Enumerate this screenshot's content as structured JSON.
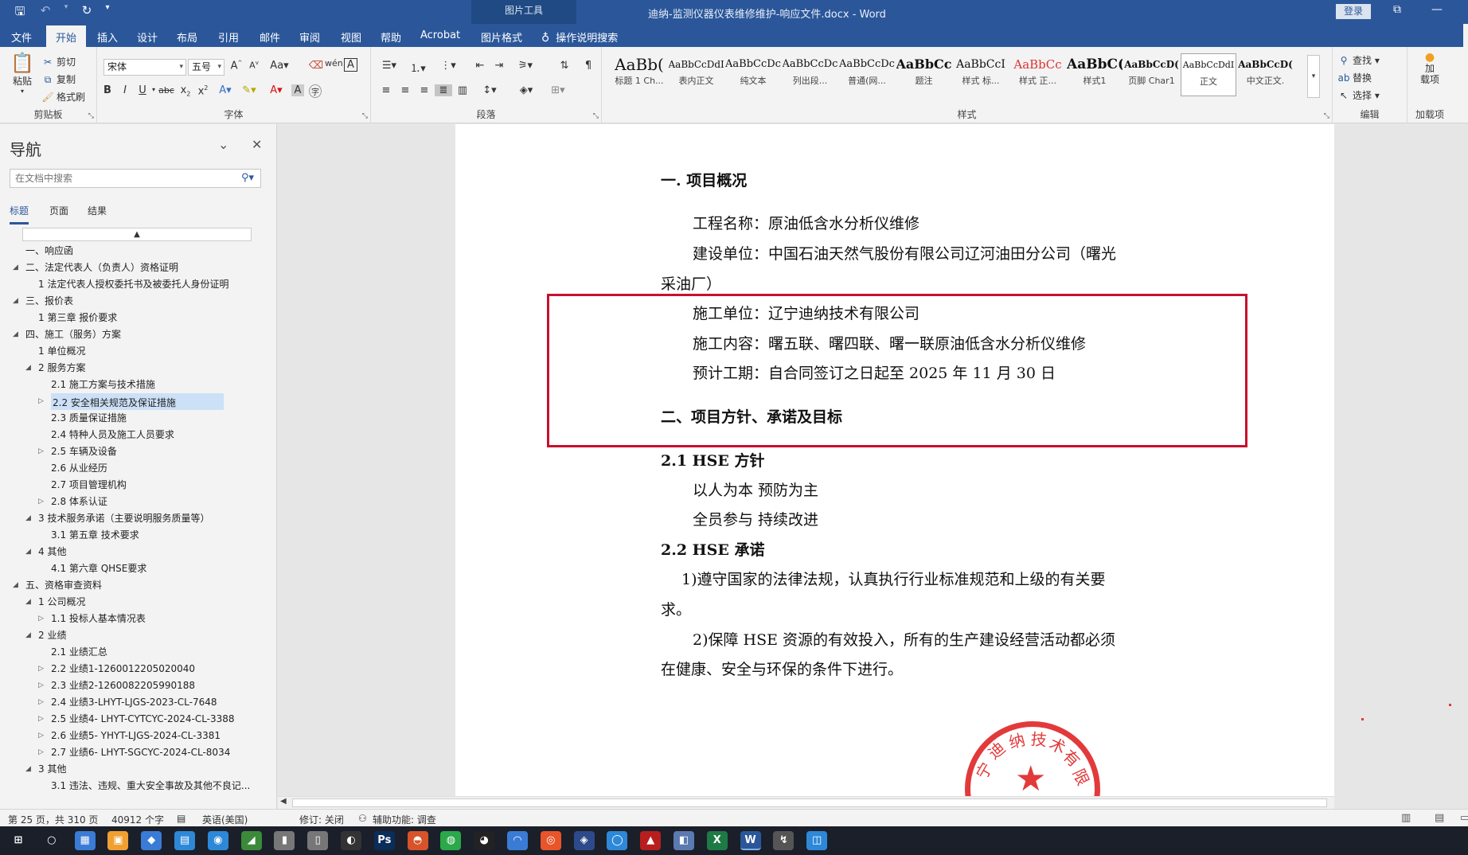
{
  "titlebar": {
    "contextual_tab": "图片工具",
    "document_title": "迪纳-监测仪器仪表维修维护-响应文件.docx  -  Word",
    "login": "登录"
  },
  "tabs": [
    {
      "label": "文件"
    },
    {
      "label": "开始"
    },
    {
      "label": "插入"
    },
    {
      "label": "设计"
    },
    {
      "label": "布局"
    },
    {
      "label": "引用"
    },
    {
      "label": "邮件"
    },
    {
      "label": "审阅"
    },
    {
      "label": "视图"
    },
    {
      "label": "帮助"
    },
    {
      "label": "Acrobat"
    },
    {
      "label": "图片格式"
    }
  ],
  "tell_me": "操作说明搜索",
  "ribbon": {
    "clipboard": {
      "paste": "粘贴",
      "cut": "剪切",
      "copy": "复制",
      "format_painter": "格式刷",
      "label": "剪贴板"
    },
    "font": {
      "name": "宋体",
      "size": "五号",
      "label": "字体"
    },
    "paragraph": {
      "label": "段落"
    },
    "styles": {
      "label": "样式",
      "items": [
        {
          "sample": "AaBb(",
          "name": "标题 1 Ch..."
        },
        {
          "sample": "AaBbCcDdI",
          "name": "表内正文"
        },
        {
          "sample": "AaBbCcDc",
          "name": "纯文本"
        },
        {
          "sample": "AaBbCcDc",
          "name": "列出段..."
        },
        {
          "sample": "AaBbCcDc",
          "name": "普通(网..."
        },
        {
          "sample": "AaBbCc",
          "name": "题注"
        },
        {
          "sample": "AaBbCcI",
          "name": "样式 标..."
        },
        {
          "sample": "AaBbCc",
          "name": "样式 正..."
        },
        {
          "sample": "AaBbC(",
          "name": "样式1"
        },
        {
          "sample": "AaBbCcD(",
          "name": "页脚 Char1"
        },
        {
          "sample": "AaBbCcDdI",
          "name": "正文"
        },
        {
          "sample": "AaBbCcD(",
          "name": "中文正文."
        }
      ]
    },
    "editing": {
      "find": "查找",
      "replace": "替换",
      "select": "选择",
      "label": "编辑"
    },
    "addins": {
      "button": "加\n载项",
      "label": "加载项"
    }
  },
  "nav": {
    "title": "导航",
    "search_placeholder": "在文档中搜索",
    "tabs": [
      {
        "label": "标题"
      },
      {
        "label": "页面"
      },
      {
        "label": "结果"
      }
    ],
    "items": [
      {
        "text": "一、响应函",
        "level": 0,
        "expand": ""
      },
      {
        "text": "二、法定代表人（负责人）资格证明",
        "level": 0,
        "expand": "open"
      },
      {
        "text": "1 法定代表人授权委托书及被委托人身份证明",
        "level": 1,
        "expand": ""
      },
      {
        "text": "三、报价表",
        "level": 0,
        "expand": "open"
      },
      {
        "text": "1 第三章 报价要求",
        "level": 1,
        "expand": ""
      },
      {
        "text": "四、施工（服务）方案",
        "level": 0,
        "expand": "open"
      },
      {
        "text": "1 单位概况",
        "level": 1,
        "expand": ""
      },
      {
        "text": "2 服务方案",
        "level": 1,
        "expand": "open"
      },
      {
        "text": "2.1 施工方案与技术措施",
        "level": 2,
        "expand": ""
      },
      {
        "text": "2.2 安全相关规范及保证措施",
        "level": 2,
        "expand": "closed",
        "selected": true
      },
      {
        "text": "2.3 质量保证措施",
        "level": 2,
        "expand": ""
      },
      {
        "text": "2.4 特种人员及施工人员要求",
        "level": 2,
        "expand": ""
      },
      {
        "text": "2.5 车辆及设备",
        "level": 2,
        "expand": "closed"
      },
      {
        "text": "2.6 从业经历",
        "level": 2,
        "expand": ""
      },
      {
        "text": "2.7 项目管理机构",
        "level": 2,
        "expand": ""
      },
      {
        "text": "2.8 体系认证",
        "level": 2,
        "expand": "closed"
      },
      {
        "text": "3 技术服务承诺（主要说明服务质量等）",
        "level": 1,
        "expand": "open"
      },
      {
        "text": "3.1 第五章 技术要求",
        "level": 2,
        "expand": ""
      },
      {
        "text": "4 其他",
        "level": 1,
        "expand": "open"
      },
      {
        "text": "4.1 第六章 QHSE要求",
        "level": 2,
        "expand": ""
      },
      {
        "text": "五、资格审查资料",
        "level": 0,
        "expand": "open"
      },
      {
        "text": "1 公司概况",
        "level": 1,
        "expand": "open"
      },
      {
        "text": "1.1 投标人基本情况表",
        "level": 2,
        "expand": "closed"
      },
      {
        "text": "2 业绩",
        "level": 1,
        "expand": "open"
      },
      {
        "text": "2.1 业绩汇总",
        "level": 2,
        "expand": ""
      },
      {
        "text": "2.2 业绩1-1260012205020040",
        "level": 2,
        "expand": "closed"
      },
      {
        "text": "2.3 业绩2-1260082205990188",
        "level": 2,
        "expand": "closed"
      },
      {
        "text": "2.4 业绩3-LHYT-LJGS-2023-CL-7648",
        "level": 2,
        "expand": "closed"
      },
      {
        "text": "2.5 业绩4- LHYT-CYTCYC-2024-CL-3388",
        "level": 2,
        "expand": "closed"
      },
      {
        "text": "2.6 业绩5- YHYT-LJGS-2024-CL-3381",
        "level": 2,
        "expand": "closed"
      },
      {
        "text": "2.7 业绩6- LHYT-SGCYC-2024-CL-8034",
        "level": 2,
        "expand": "closed"
      },
      {
        "text": "3 其他",
        "level": 1,
        "expand": "open"
      },
      {
        "text": "3.1 违法、违规、重大安全事故及其他不良记...",
        "level": 2,
        "expand": ""
      }
    ]
  },
  "document": {
    "h1": "一. 项目概况",
    "project_name": "工程名称：原油低含水分析仪维修",
    "builder_line1": "建设单位：中国石油天然气股份有限公司辽河油田分公司（曙光",
    "builder_line2": "采油厂）",
    "constructor": "施工单位：辽宁迪纳技术有限公司",
    "content": "施工内容：曙五联、曙四联、曙一联原油低含水分析仪维修",
    "period": "预计工期：自合同签订之日起至 2025 年 11 月 30 日",
    "h2": "二、项目方针、承诺及目标",
    "h21": "2.1 HSE 方针",
    "policy1": "以人为本 预防为主",
    "policy2": "全员参与 持续改进",
    "h22": "2.2 HSE 承诺",
    "commit1_line1": "1)遵守国家的法律法规，认真执行行业标准规范和上级的有关要",
    "commit1_line2": "求。",
    "commit2_line1": "2)保障 HSE 资源的有效投入，所有的生产建设经营活动都必须",
    "commit2_line2": "在健康、安全与环保的条件下进行。",
    "seal_chars": [
      "宁",
      "迪",
      "纳",
      "技",
      "术",
      "有",
      "限"
    ]
  },
  "status": {
    "page": "第 25 页，共 310 页",
    "words": "40912 个字",
    "language": "英语(美国)",
    "track": "修订: 关闭",
    "accessibility": "辅助功能: 调查"
  },
  "taskbar": {
    "items": [
      {
        "icon": "windows-icon",
        "glyph": "⊞"
      },
      {
        "icon": "search-icon",
        "glyph": "○"
      },
      {
        "icon": "calculator-icon",
        "glyph": "▦"
      },
      {
        "icon": "file-explorer-icon",
        "glyph": "▣"
      },
      {
        "icon": "app-icon",
        "glyph": "◆"
      },
      {
        "icon": "app-icon",
        "glyph": "▤"
      },
      {
        "icon": "app-icon",
        "glyph": "◉"
      },
      {
        "icon": "app-icon",
        "glyph": "◢"
      },
      {
        "icon": "app-icon",
        "glyph": "▮"
      },
      {
        "icon": "document-icon",
        "glyph": "▯"
      },
      {
        "icon": "app-icon",
        "glyph": "◐"
      },
      {
        "icon": "photoshop-icon",
        "glyph": "Ps"
      },
      {
        "icon": "app-icon",
        "glyph": "◓"
      },
      {
        "icon": "wechat-icon",
        "glyph": "◍"
      },
      {
        "icon": "qq-icon",
        "glyph": "◕"
      },
      {
        "icon": "app-icon",
        "glyph": "◠"
      },
      {
        "icon": "browser-icon",
        "glyph": "◎"
      },
      {
        "icon": "app-icon",
        "glyph": "◈"
      },
      {
        "icon": "edge-icon",
        "glyph": "◯"
      },
      {
        "icon": "acrobat-icon",
        "glyph": "▲"
      },
      {
        "icon": "app-icon",
        "glyph": "◧"
      },
      {
        "icon": "excel-icon",
        "glyph": "X"
      },
      {
        "icon": "word-icon",
        "glyph": "W"
      },
      {
        "icon": "app-icon",
        "glyph": "↯"
      },
      {
        "icon": "app-icon",
        "glyph": "◫"
      }
    ]
  }
}
